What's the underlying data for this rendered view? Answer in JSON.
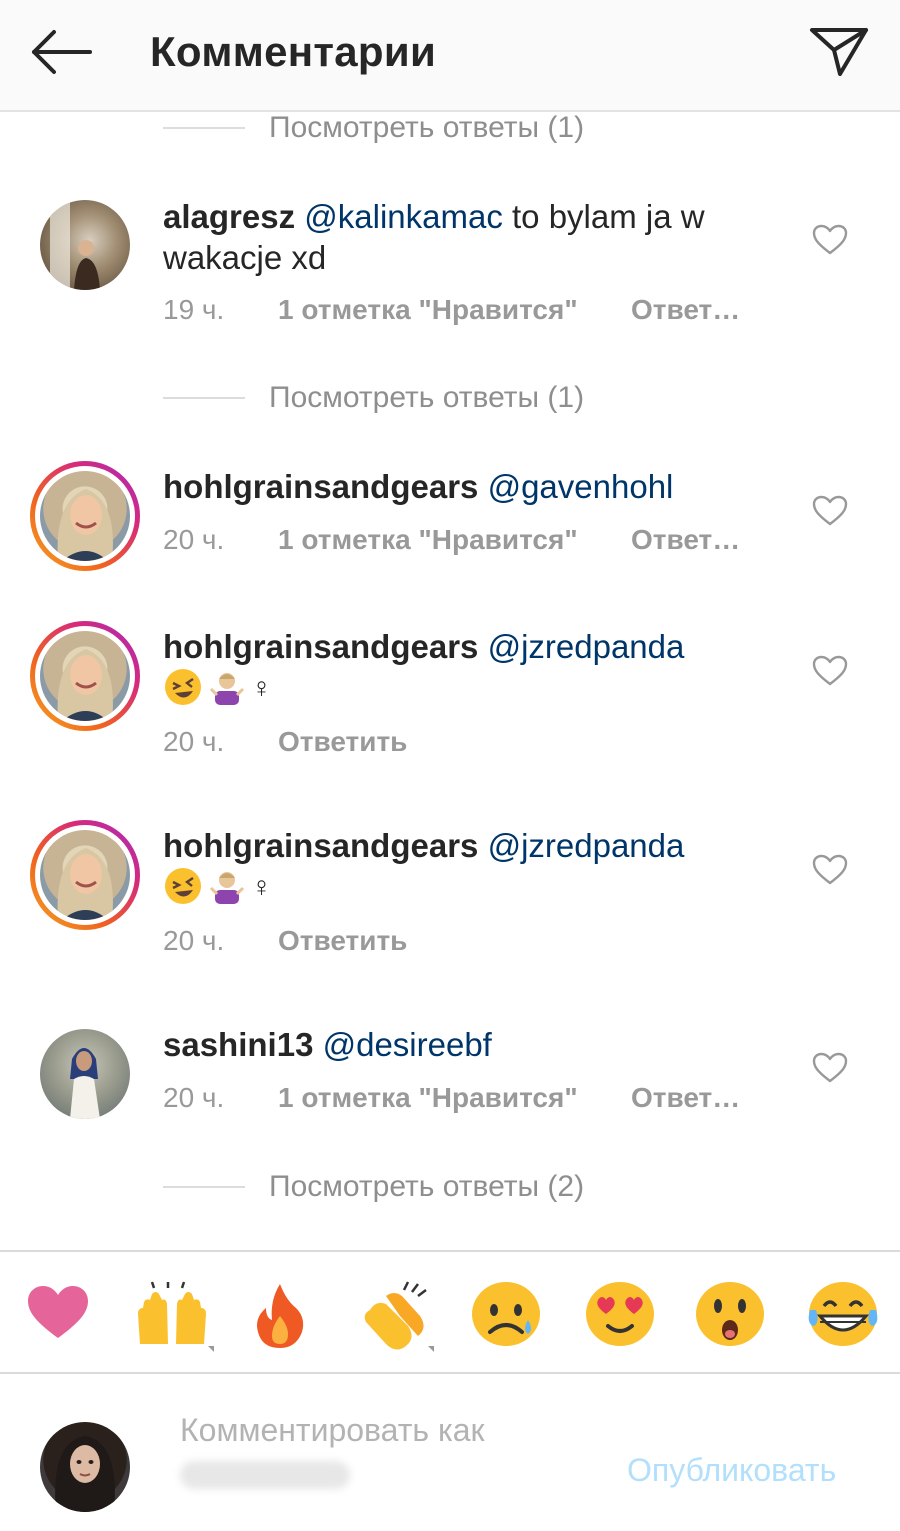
{
  "header": {
    "title": "Комментарии",
    "back_icon": "arrow-left-icon",
    "share_icon": "paper-plane-icon"
  },
  "view_replies": [
    {
      "label": "Посмотреть ответы (1)"
    },
    {
      "label": "Посмотреть ответы (1)"
    },
    {
      "label": "Посмотреть ответы (2)"
    }
  ],
  "comments": [
    {
      "username": "alagresz",
      "mention": "@kalinkamac",
      "text": " to bylam ja w wakacje xd",
      "time": "19 ч.",
      "likes": "1 отметка \"Нравится\"",
      "reply": "Ответить"
    },
    {
      "username": "hohlgrainsandgears",
      "mention": "@gavenhohl",
      "text": "",
      "time": "20 ч.",
      "likes": "1 отметка \"Нравится\"",
      "reply": "Ответить"
    },
    {
      "username": "hohlgrainsandgears",
      "mention": "@jzredpanda",
      "text": "",
      "emoji_text": "♀",
      "time": "20 ч.",
      "reply": "Ответить"
    },
    {
      "username": "hohlgrainsandgears",
      "mention": "@jzredpanda",
      "text": "",
      "emoji_text": "♀",
      "time": "20 ч.",
      "reply": "Ответить"
    },
    {
      "username": "sashini13",
      "mention": "@desireebf",
      "text": "",
      "time": "20 ч.",
      "likes": "1 отметка \"Нравится\"",
      "reply": "Ответить"
    }
  ],
  "reactions": [
    {
      "icon": "heart-emoji-icon"
    },
    {
      "icon": "raising-hands-emoji-icon"
    },
    {
      "icon": "fire-emoji-icon"
    },
    {
      "icon": "clapping-hands-emoji-icon"
    },
    {
      "icon": "sad-face-emoji-icon"
    },
    {
      "icon": "heart-eyes-emoji-icon"
    },
    {
      "icon": "surprised-face-emoji-icon"
    },
    {
      "icon": "tears-of-joy-emoji-icon"
    }
  ],
  "composer": {
    "placeholder": "Комментировать как",
    "publish_label": "Опубликовать"
  },
  "colors": {
    "mention": "#003569",
    "meta": "#999999",
    "publish_disabled": "#b2dffc",
    "story_ring_start": "#f5a623",
    "story_ring_end": "#a32cc4"
  }
}
